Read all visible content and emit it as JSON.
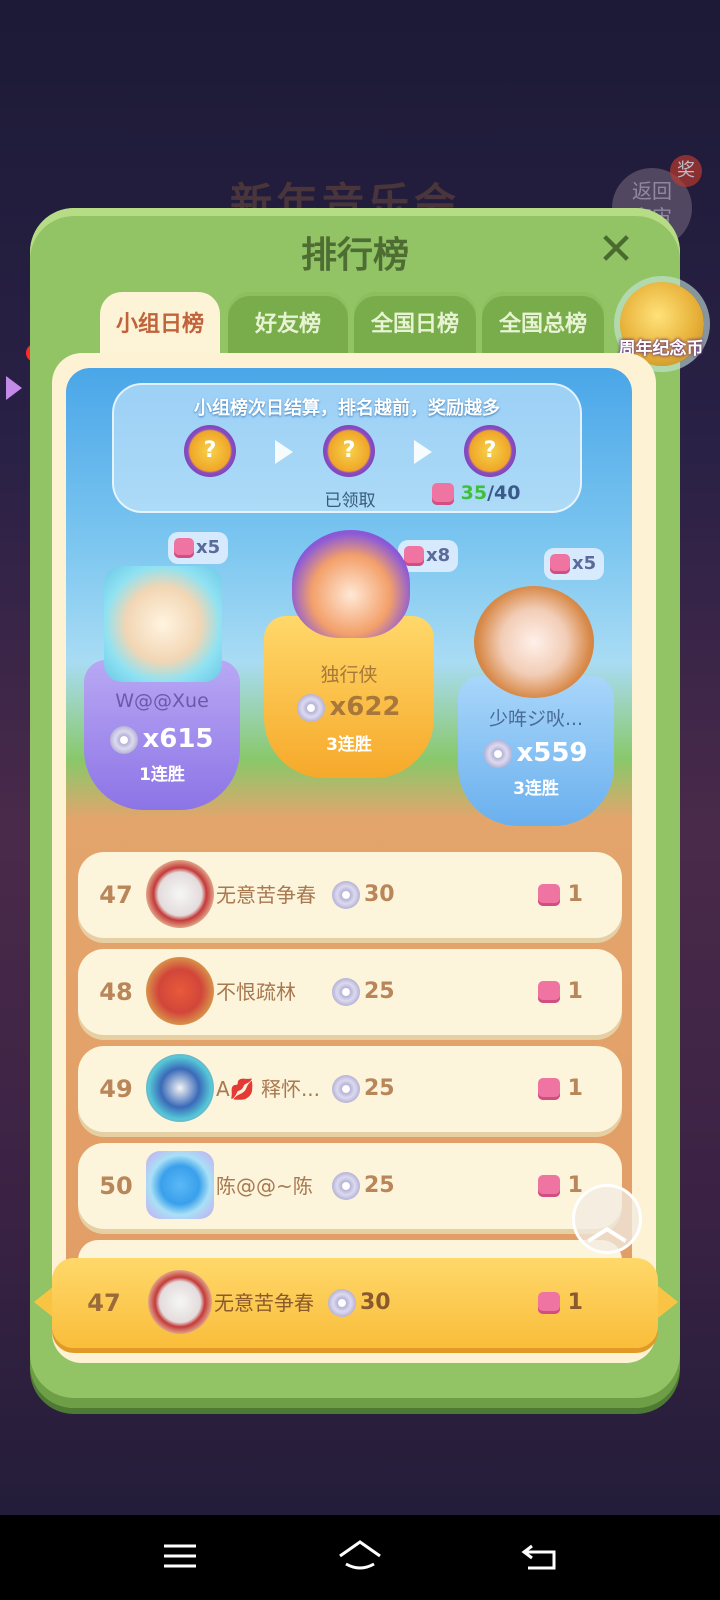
{
  "background": {
    "event_title": "新年音乐会",
    "return_label_line1": "返回",
    "return_label_line2": "宇宙",
    "return_badge": "奖"
  },
  "panel": {
    "title": "排行榜",
    "close_icon": "close-icon"
  },
  "tabs": [
    {
      "label": "小组日榜",
      "active": true
    },
    {
      "label": "好友榜",
      "active": false
    },
    {
      "label": "全国日榜",
      "active": false
    },
    {
      "label": "全国总榜",
      "active": false
    }
  ],
  "anniversary_coin": {
    "label": "周年纪念币"
  },
  "reward_info": {
    "text": "小组榜次日结算，排名越前，奖励越多",
    "claimed_label": "已领取",
    "progress_current": "35",
    "progress_total": "/40",
    "progress_fraction": 0.875
  },
  "podium": [
    {
      "place": 1,
      "name": "独行侠",
      "score": "x622",
      "streak": "3连胜",
      "reward": "x8"
    },
    {
      "place": 2,
      "name": "W@@Xue",
      "score": "x615",
      "streak": "1连胜",
      "reward": "x5"
    },
    {
      "place": 3,
      "name": "少哖ジ吙...",
      "score": "x559",
      "streak": "3连胜",
      "reward": "x5"
    }
  ],
  "ranks": [
    {
      "rank": "47",
      "name": "无意苦争春",
      "score": "30",
      "reward": "1"
    },
    {
      "rank": "48",
      "name": "不恨疏林",
      "score": "25",
      "reward": "1"
    },
    {
      "rank": "49",
      "name": "A💋 释怀...",
      "score": "25",
      "reward": "1"
    },
    {
      "rank": "50",
      "name": "陈@@~陈",
      "score": "25",
      "reward": "1"
    }
  ],
  "my_rank": {
    "rank": "47",
    "name": "无意苦争春",
    "score": "30",
    "reward": "1"
  },
  "colors": {
    "panel_green": "#92c466",
    "tab_active_text": "#c0623a",
    "gold": "#f9bd3a",
    "progress_green": "#3fbf3a"
  },
  "nav": {
    "menu_icon": "menu-icon",
    "home_icon": "home-icon",
    "back_icon": "back-icon"
  }
}
